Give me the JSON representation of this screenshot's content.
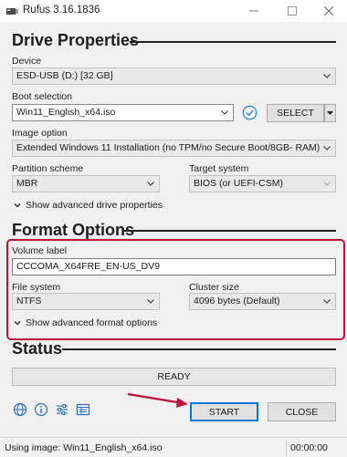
{
  "window": {
    "title": "Rufus 3.16.1836"
  },
  "drive_properties": {
    "heading": "Drive Properties",
    "device_label": "Device",
    "device_value": "ESD-USB (D:) [32 GB]",
    "boot_selection_label": "Boot selection",
    "boot_selection_value": "Win11_English_x64.iso",
    "select_button": "SELECT",
    "image_option_label": "Image option",
    "image_option_value": "Extended Windows 11 Installation (no TPM/no Secure Boot/8GB- RAM)",
    "partition_scheme_label": "Partition scheme",
    "partition_scheme_value": "MBR",
    "target_system_label": "Target system",
    "target_system_value": "BIOS (or UEFI-CSM)",
    "advanced_toggle": "Show advanced drive properties"
  },
  "format_options": {
    "heading": "Format Options",
    "volume_label_label": "Volume label",
    "volume_label_value": "CCCOMA_X64FRE_EN-US_DV9",
    "file_system_label": "File system",
    "file_system_value": "NTFS",
    "cluster_size_label": "Cluster size",
    "cluster_size_value": "4096 bytes (Default)",
    "advanced_toggle": "Show advanced format options"
  },
  "status": {
    "heading": "Status",
    "progress_text": "READY",
    "progress_fraction": 0
  },
  "actions": {
    "start": "START",
    "close": "CLOSE"
  },
  "toolbar_icons": [
    "globe-icon",
    "info-icon",
    "settings-sliders-icon",
    "log-icon"
  ],
  "statusbar": {
    "message": "Using image: Win11_English_x64.iso",
    "elapsed": "00:00:00"
  },
  "colors": {
    "highlight": "#c0143c",
    "accent": "#0078d7",
    "check": "#3d8fd8"
  }
}
